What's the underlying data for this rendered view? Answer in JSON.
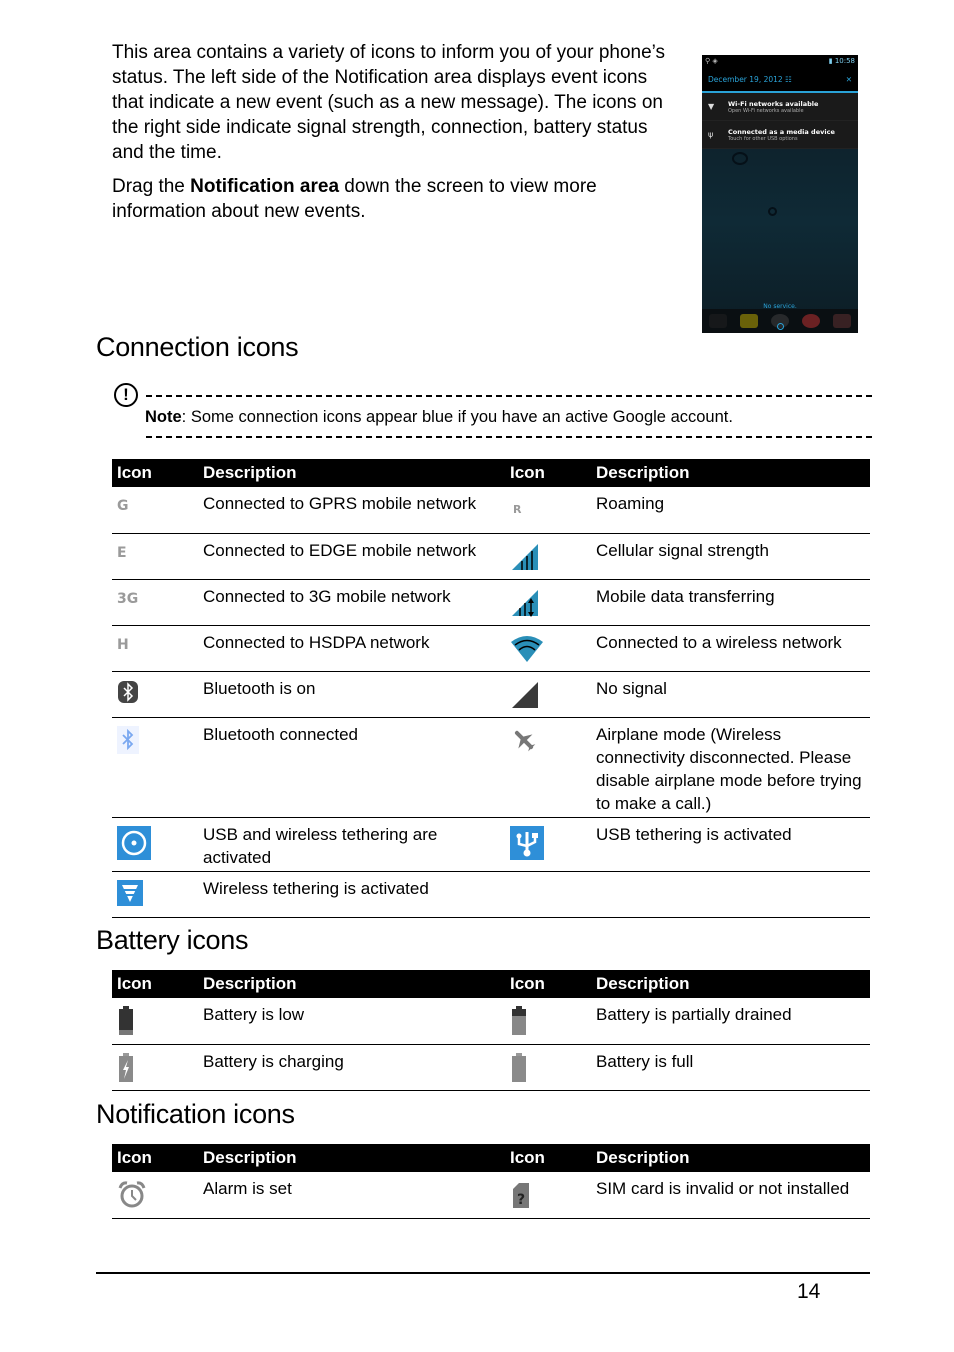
{
  "intro": {
    "paragraph1": "This area contains a variety of icons to inform you of your phone’s status. The left side of the Notification area displays event icons that indicate a new event (such as a new message). The icons on the right side indicate signal strength, connection, battery status and the time.",
    "paragraph2_prefix": "Drag the ",
    "paragraph2_bold": "Notification area",
    "paragraph2_suffix": " down the screen to view more information about new events."
  },
  "phone_screenshot": {
    "time": "10:58",
    "date": "December 19, 2012",
    "notifications": [
      {
        "title": "Wi-Fi networks available",
        "subtitle": "Open Wi-Fi networks available",
        "icon": "wifi-icon"
      },
      {
        "title": "Connected as a media device",
        "subtitle": "Touch for other USB options",
        "icon": "usb-icon"
      }
    ],
    "footer_text": "No service."
  },
  "sections": {
    "connection": {
      "title": "Connection icons",
      "note_label": "Note",
      "note_text": ": Some connection icons appear blue if you have an active Google account.",
      "headers": [
        "Icon",
        "Description",
        "Icon",
        "Description"
      ],
      "rows": [
        {
          "left_icon": "G",
          "left_desc": "Connected to GPRS mobile network",
          "right_icon": "roaming-icon",
          "right_desc": "Roaming"
        },
        {
          "left_icon": "E",
          "left_desc": "Connected to EDGE mobile network",
          "right_icon": "cellular-signal-icon",
          "right_desc": "Cellular signal strength"
        },
        {
          "left_icon": "3G",
          "left_desc": "Connected to 3G mobile network",
          "right_icon": "mobile-data-icon",
          "right_desc": "Mobile data transferring"
        },
        {
          "left_icon": "H",
          "left_desc": "Connected to HSDPA network",
          "right_icon": "wifi-icon",
          "right_desc": "Connected to a wireless network"
        },
        {
          "left_icon": "bluetooth-on-icon",
          "left_desc": "Bluetooth is on",
          "right_icon": "no-signal-icon",
          "right_desc": "No signal"
        },
        {
          "left_icon": "bluetooth-connected-icon",
          "left_desc": "Bluetooth connected",
          "right_icon": "airplane-icon",
          "right_desc": "Airplane mode (Wireless connectivity disconnected. Please disable airplane mode before trying to make a call.)"
        },
        {
          "left_icon": "usb-wifi-tethering-icon",
          "left_desc": "USB and wireless tethering are activated",
          "right_icon": "usb-tethering-icon",
          "right_desc": "USB tethering is activated"
        },
        {
          "left_icon": "wifi-tethering-icon",
          "left_desc": "Wireless tethering is activated",
          "right_icon": "",
          "right_desc": ""
        }
      ]
    },
    "battery": {
      "title": "Battery icons",
      "headers": [
        "Icon",
        "Description",
        "Icon",
        "Description"
      ],
      "rows": [
        {
          "left_icon": "battery-low-icon",
          "left_desc": "Battery is low",
          "right_icon": "battery-partial-icon",
          "right_desc": "Battery is partially drained"
        },
        {
          "left_icon": "battery-charging-icon",
          "left_desc": "Battery is charging",
          "right_icon": "battery-full-icon",
          "right_desc": "Battery is full"
        }
      ]
    },
    "notification": {
      "title": "Notification icons",
      "headers": [
        "Icon",
        "Description",
        "Icon",
        "Description"
      ],
      "rows": [
        {
          "left_icon": "alarm-icon",
          "left_desc": "Alarm is set",
          "right_icon": "sim-invalid-icon",
          "right_desc": "SIM card is invalid or not installed"
        }
      ]
    }
  },
  "colors": {
    "icon_blue": "#2e8fd8",
    "signal_blue": "#2a8fb8",
    "icon_gray": "#9a9a9a",
    "dark_gray": "#3a3a3a"
  },
  "page_number": "14"
}
